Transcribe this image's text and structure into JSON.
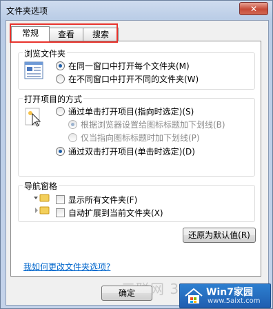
{
  "window": {
    "title": "文件夹选项",
    "close_glyph": "✕"
  },
  "tabs": [
    {
      "label": "常规",
      "active": true
    },
    {
      "label": "查看",
      "active": false
    },
    {
      "label": "搜索",
      "active": false
    }
  ],
  "browse_group": {
    "title": "浏览文件夹",
    "icon": "folder-window-icon",
    "options": [
      {
        "label": "在同一窗口中打开每个文件夹(M)",
        "checked": true
      },
      {
        "label": "在不同窗口中打开不同的文件夹(W)",
        "checked": false
      }
    ]
  },
  "open_group": {
    "title": "打开项目的方式",
    "icon": "cursor-click-icon",
    "options": [
      {
        "label": "通过单击打开项目(指向时选定)(S)",
        "checked": false
      },
      {
        "label": "根据浏览器设置给图标标题加下划线(B)",
        "checked": true,
        "disabled": true
      },
      {
        "label": "仅当指向图标标题时加下划线(P)",
        "checked": false,
        "disabled": true
      },
      {
        "label": "通过双击打开项目(单击时选定)(D)",
        "checked": true
      }
    ]
  },
  "nav_group": {
    "title": "导航窗格",
    "options": [
      {
        "label": "显示所有文件夹(F)",
        "checked": false
      },
      {
        "label": "自动扩展到当前文件夹(X)",
        "checked": false
      }
    ]
  },
  "restore_button": "还原为默认值(R)",
  "help_link": "我如何更改文件夹选项?",
  "ok_button": "确定",
  "watermark": "三联网 3LIAN.COM",
  "logo": {
    "title": "Win7家园",
    "url": "www.5aixt.com"
  },
  "colors": {
    "highlight": "#e8322b",
    "link": "#0066cc",
    "radio_dot": "#1f5ea8",
    "title_bar": "#c4d3ea"
  }
}
